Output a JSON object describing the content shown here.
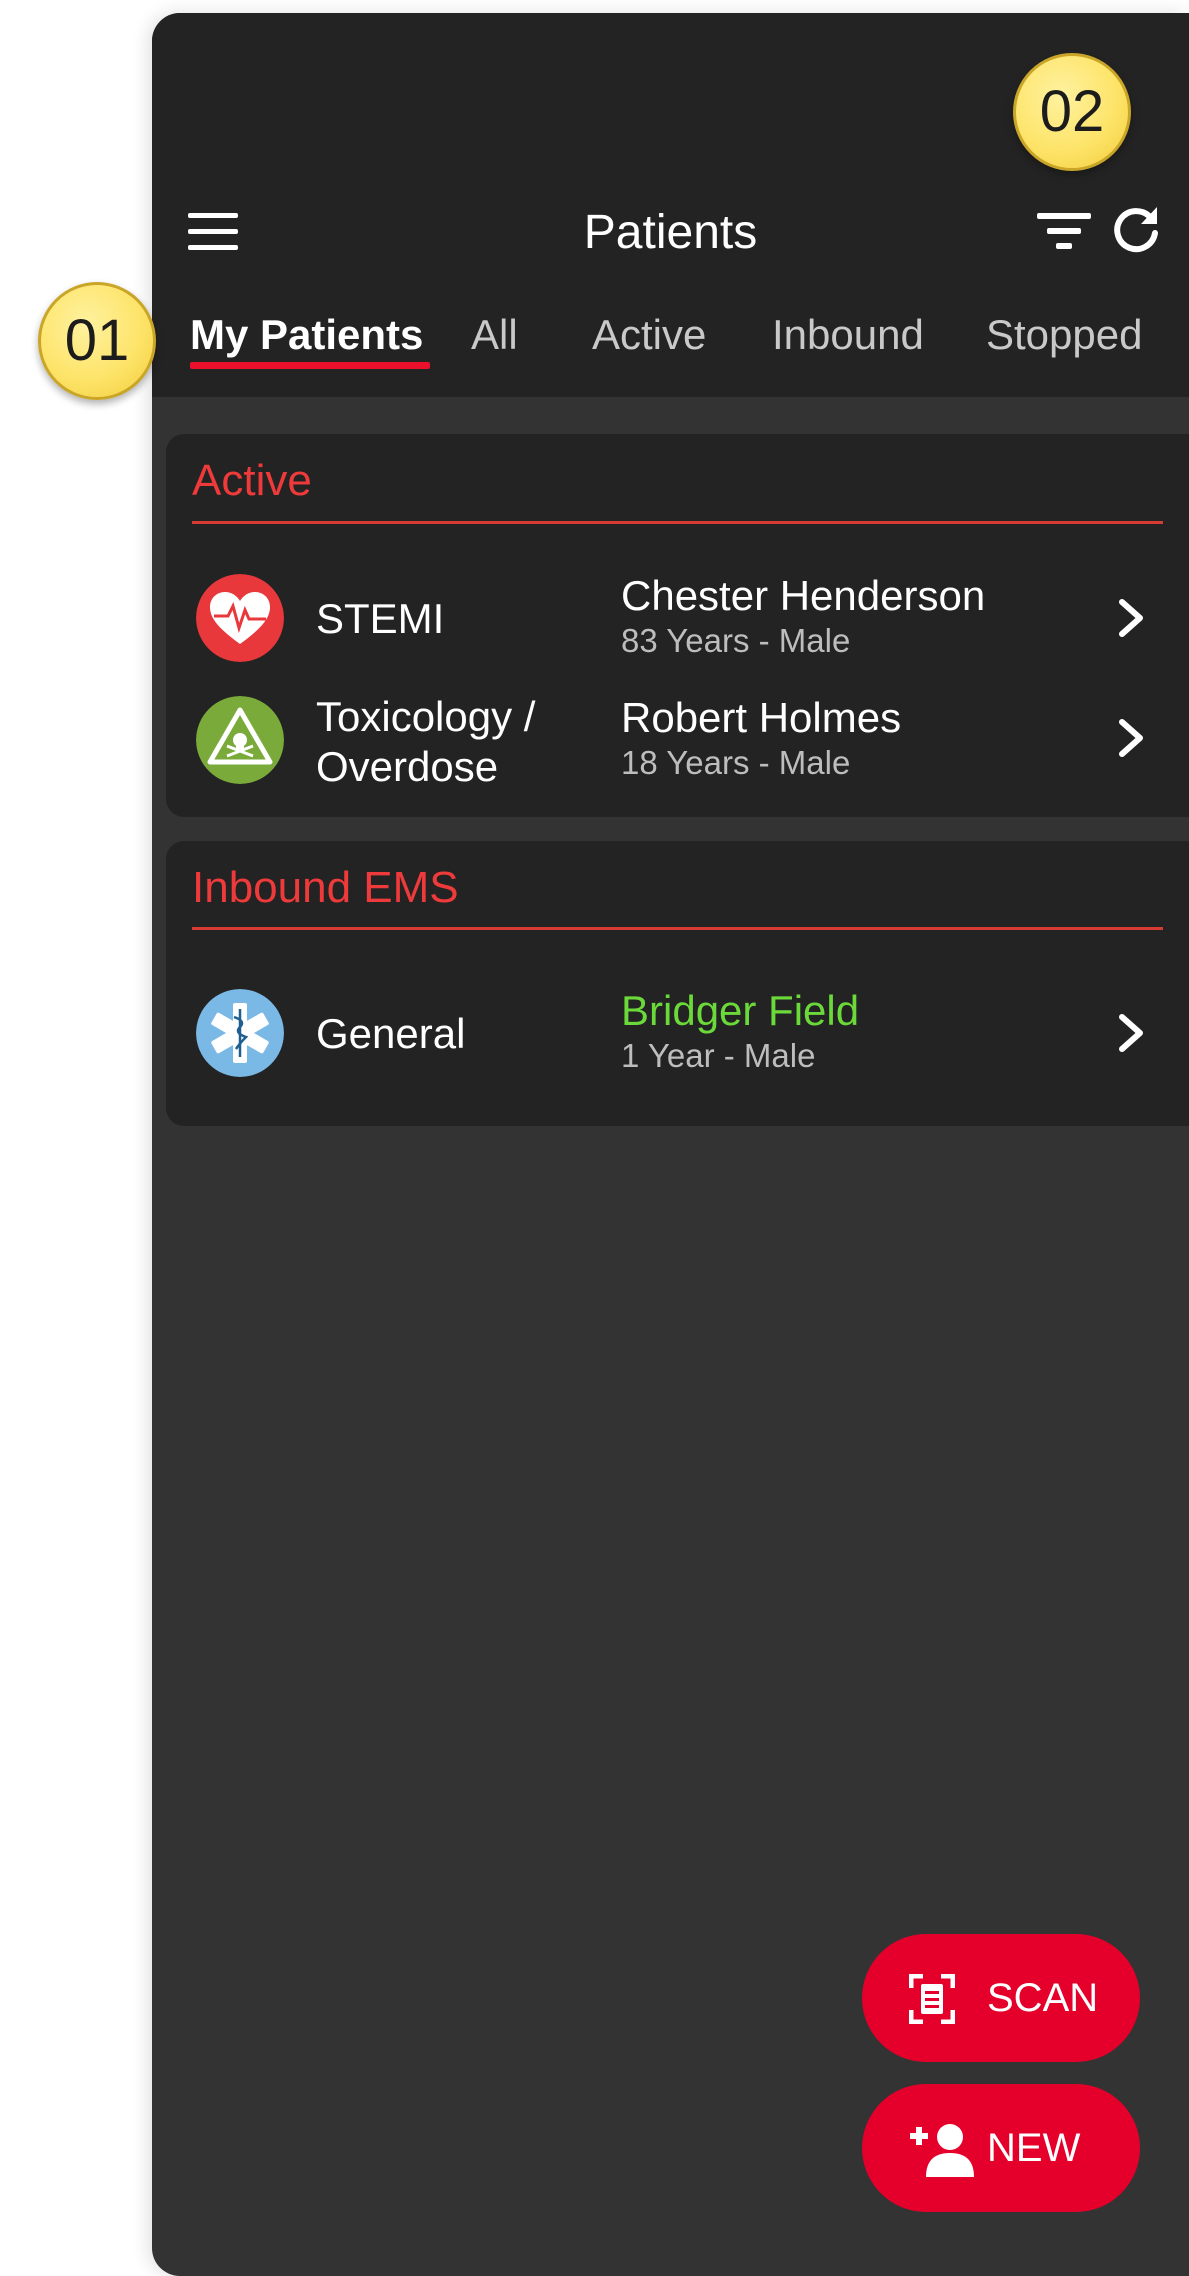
{
  "header": {
    "title": "Patients",
    "menu_icon": "hamburger-menu-icon",
    "filter_icon": "filter-icon",
    "refresh_icon": "refresh-icon"
  },
  "tabs": [
    {
      "label": "My Patients",
      "active": true
    },
    {
      "label": "All",
      "active": false
    },
    {
      "label": "Active",
      "active": false
    },
    {
      "label": "Inbound",
      "active": false
    },
    {
      "label": "Stopped",
      "active": false
    }
  ],
  "sections": [
    {
      "title": "Active",
      "rows": [
        {
          "category": "STEMI",
          "icon": "heart-ecg-icon",
          "icon_color": "#e8383b",
          "name": "Chester Henderson",
          "info": "83 Years - Male"
        },
        {
          "category_line1": "Toxicology /",
          "category_line2": "Overdose",
          "icon": "toxic-hazard-icon",
          "icon_color": "#7aab3a",
          "name": "Robert Holmes",
          "info": "18 Years - Male"
        }
      ]
    },
    {
      "title": "Inbound EMS",
      "rows": [
        {
          "category": "General",
          "icon": "star-of-life-icon",
          "icon_color": "#7ab8e6",
          "name": "Bridger Field",
          "name_color": "#6bd93a",
          "info": "1 Year - Male"
        }
      ]
    }
  ],
  "actions": {
    "scan_label": "SCAN",
    "new_label": "NEW",
    "accent": "#e4002b"
  },
  "callouts": {
    "left": "01",
    "right": "02"
  }
}
